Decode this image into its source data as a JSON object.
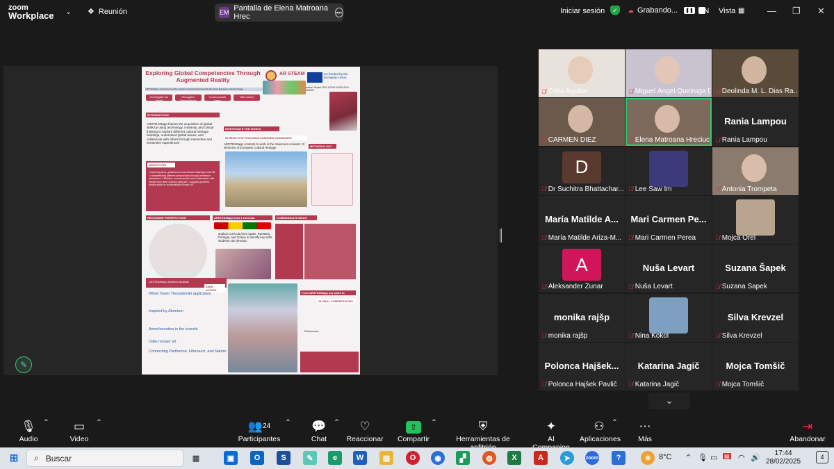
{
  "app": {
    "logo_line1": "zoom",
    "logo_line2": "Workplace",
    "meeting_label": "Reunión"
  },
  "share_pill": {
    "initials": "EM",
    "label": "Pantalla de Elena Matroana Hrec"
  },
  "topright": {
    "signin": "Iniciar sesión",
    "recording": "Grabando...",
    "language": "EN",
    "view": "Vista"
  },
  "poster": {
    "title": "Exploring Global Competencies Through Augmented Reality",
    "subtitle": "ARSTEAMapp: Fostering scientific vocations through Augmented Reality about European cultural heritage",
    "pills": [
      "Investigate the World",
      "Recognize Perspectives",
      "Communicate Ideas",
      "Take Action"
    ],
    "brand": "AR STEAM",
    "cofunded": "Co-funded by the European Union",
    "project": "Erasmus+ Project 2021-1-ES01-KA220-SCH-000030517",
    "sections": {
      "intro_h": "INTRODUCTION",
      "intro_t": "ARSTEAMapp fosters the acquisition of global skills by using technology, creativity, and critical thinking to explore different cultural heritage buildings, understand global issues, and collaborate with others through interactive and immersive experiences",
      "obj_h": "OBJECTIVES",
      "obj_t": "• Exploring local, global and cross-cultural challenges with AR. • Understanding different perspectives through immersive simulations. • Effective communication and collaboration with people from other cultures using AR. • Applying problem-solving skills for sustainability through AR.",
      "inv_h": "INVESTIGATE THE WORLD",
      "inv_sub": "INTERACTIVE TEACHING-LEARNING SCENARIOS",
      "inv_t": "ARSTEAMapp contents to work in the classroom consider 10 elements of European Cultural Heritage",
      "meth_h": "METHODOLOGY",
      "rec_h": "RECOGNIZE PERSPECTIVES",
      "links_h": "ARSTEAMapp links 4 curricula",
      "links_t": "analyze curricula from Spain, Romania, Portugal, and Turkey to identify key skills students can develop.",
      "comm_h": "COMMUNICATE IDEAS",
      "act_h": "ARSTEAMapp activities facilitate",
      "take_h": "TAKE ACTION",
      "a1": "White Tower Thessaloniki application",
      "a2": "Inspired by Atomium",
      "a3": "Ameolnovation in the tunnels",
      "a4": "Dalle mosaic art",
      "a5": "Connecting Parthenon, Fibonacci, and Nature",
      "key_h": "From ARSTEAMapp key skills to",
      "glob_h": "GLOBAL COMPETENCIES",
      "refs": "References"
    }
  },
  "participants": [
    {
      "name": "Celia Aguilar",
      "type": "photo",
      "color": "#e8e2dc",
      "active": false
    },
    {
      "name": "Miguel Ángel Queiruga Di...",
      "type": "photo",
      "color": "#c9c3cf",
      "active": false
    },
    {
      "name": "Deolinda M. L. Dias Ra...",
      "type": "photo",
      "color": "#5a4a3a",
      "active": false
    },
    {
      "name": "CARMEN DIEZ",
      "type": "photo",
      "color": "#6b5a4c",
      "active": false
    },
    {
      "name": "Elena Matroana Hreciuc",
      "type": "photo",
      "color": "#7d6a5d",
      "active": true
    },
    {
      "name": "Rania Lampou",
      "type": "text",
      "big": "Rania Lampou",
      "active": false
    },
    {
      "name": "Dr Suchitra Bhattachar...",
      "type": "avatar",
      "initial": "D",
      "color": "#5a3a2e",
      "active": false
    },
    {
      "name": "Lee Saw Im",
      "type": "photo_small",
      "color": "#3d3a7a",
      "active": false
    },
    {
      "name": "Antonia Trompeta",
      "type": "photo",
      "color": "#8a7b6e",
      "active": false
    },
    {
      "name": "María Matilde Ariza-M...",
      "type": "text",
      "big": "María Matilde A...",
      "active": false
    },
    {
      "name": "Mari Carmen Perea",
      "type": "text",
      "big": "Mari Carmen Pe...",
      "active": false
    },
    {
      "name": "Mojca Orel",
      "type": "photo_small",
      "color": "#b9a58f",
      "active": false
    },
    {
      "name": "Aleksander Žunar",
      "type": "avatar",
      "initial": "A",
      "color": "#d1155b",
      "active": false
    },
    {
      "name": "Nuša Levart",
      "type": "text",
      "big": "Nuša Levart",
      "active": false
    },
    {
      "name": "Suzana Šapek",
      "type": "text",
      "big": "Suzana Šapek",
      "active": false
    },
    {
      "name": "monika rajšp",
      "type": "text",
      "big": "monika rajšp",
      "active": false
    },
    {
      "name": "Nina Kokol",
      "type": "photo_small",
      "color": "#7ea0c0",
      "active": false
    },
    {
      "name": "Silva Krevzel",
      "type": "text",
      "big": "Silva Krevzel",
      "active": false
    },
    {
      "name": "Polonca Hajšek Pavlič",
      "type": "text",
      "big": "Polonca Hajšek...",
      "active": false
    },
    {
      "name": "Katarina Jagič",
      "type": "text",
      "big": "Katarina Jagič",
      "active": false
    },
    {
      "name": "Mojca Tomšič",
      "type": "text",
      "big": "Mojca Tomšič",
      "active": false
    }
  ],
  "toolbar": {
    "audio": "Audio",
    "video": "Video",
    "participants": "Participantes",
    "participants_count": "24",
    "chat": "Chat",
    "react": "Reaccionar",
    "share": "Compartir",
    "host_tools": "Herramientas de anfitrión",
    "ai": "AI Companion",
    "apps": "Aplicaciones",
    "more": "Más",
    "leave": "Abandonar"
  },
  "taskbar": {
    "search_placeholder": "Buscar",
    "temperature": "8°C",
    "time": "17:44",
    "date": "28/02/2025",
    "notif_count": "4"
  }
}
